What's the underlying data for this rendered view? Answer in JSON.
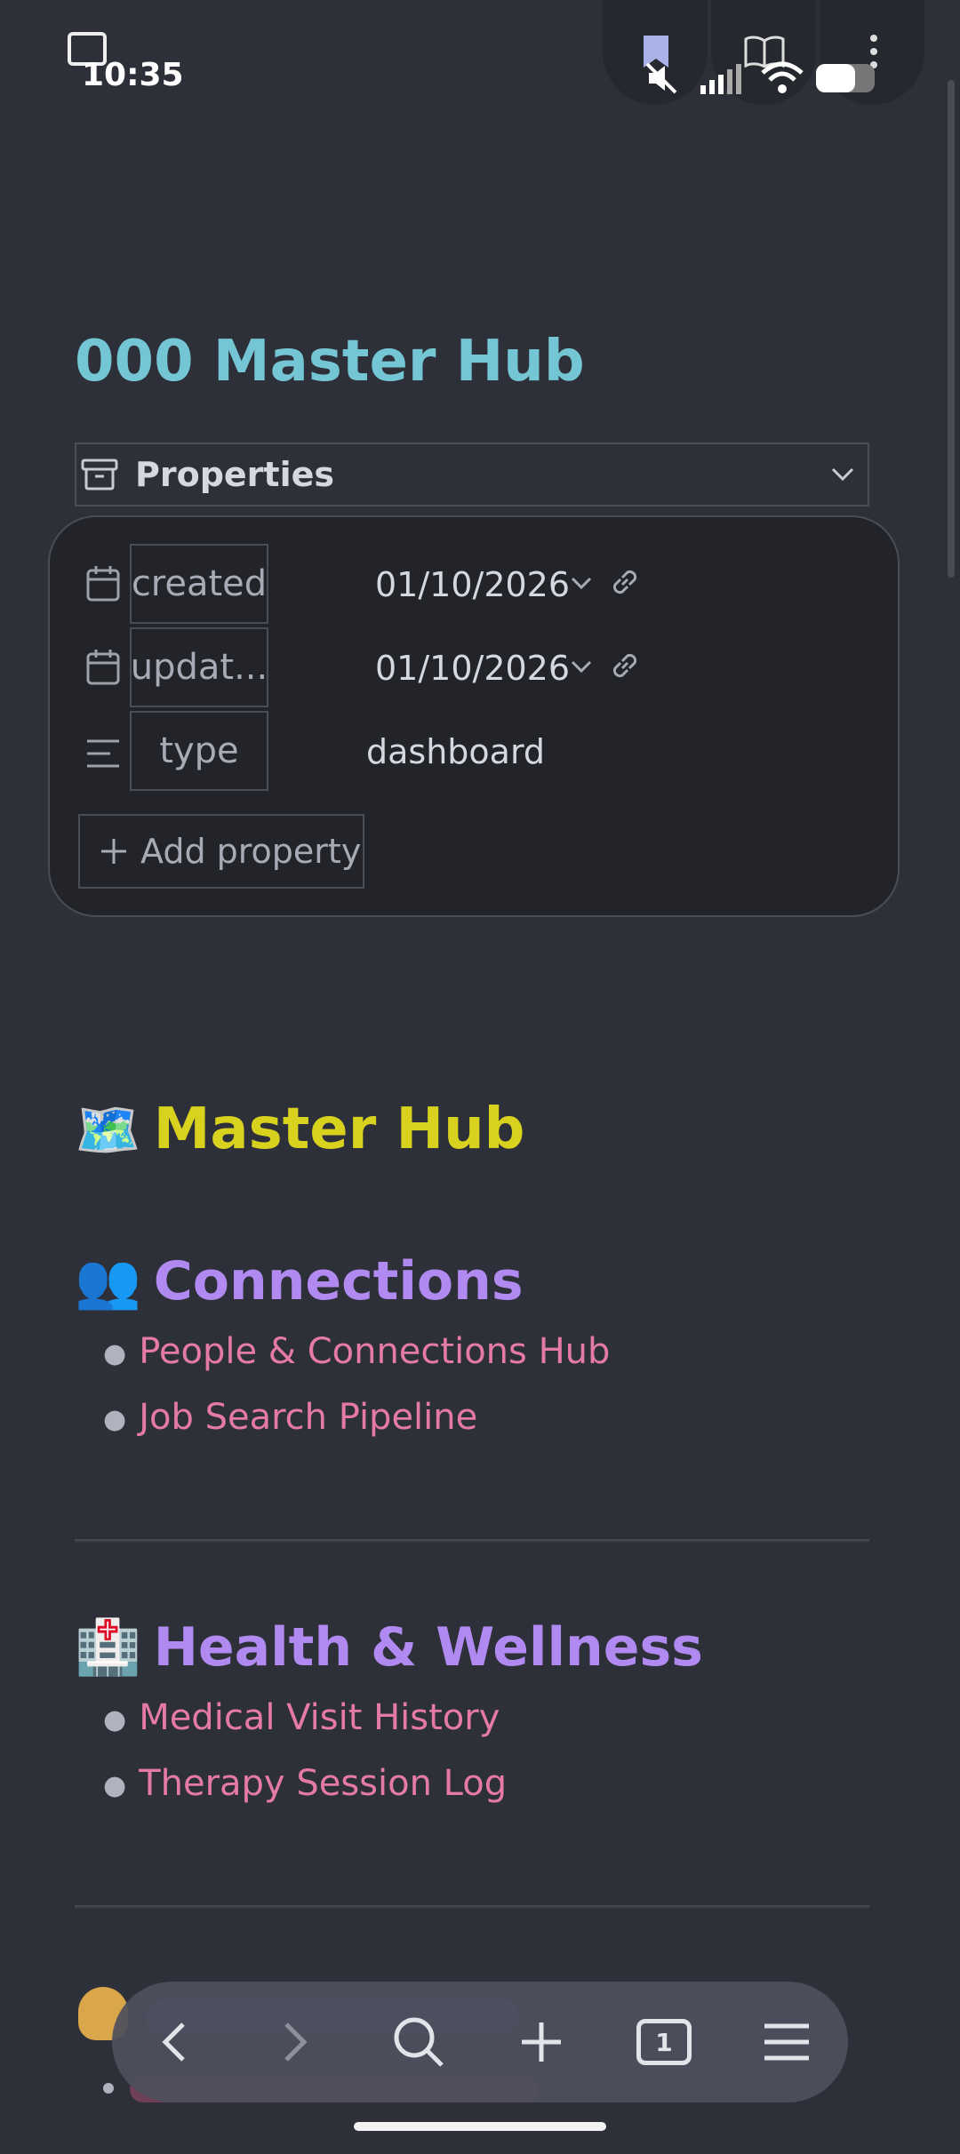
{
  "status_bar": {
    "time": "10:35"
  },
  "page": {
    "title": "000 Master Hub"
  },
  "properties": {
    "label": "Properties",
    "rows": [
      {
        "key": "created",
        "value": "01/10/2026"
      },
      {
        "key": "updat...",
        "value": "01/10/2026"
      },
      {
        "key": "type",
        "value": "dashboard"
      }
    ],
    "add_label": "Add property"
  },
  "content": {
    "heading": "Master Hub",
    "heading_emoji": "🗺️",
    "sections": [
      {
        "emoji": "👥",
        "title": "Connections",
        "links": [
          "People & Connections Hub",
          "Job Search Pipeline"
        ]
      },
      {
        "emoji": "🏥",
        "title": "Health & Wellness",
        "links": [
          "Medical Visit History",
          "Therapy Session Log"
        ]
      }
    ]
  },
  "bottom_nav": {
    "tab_count": "1"
  },
  "colors": {
    "title": "#74c6d4",
    "h1": "#d8d21e",
    "h2": "#b08af0",
    "link": "#e57aa8",
    "bg": "#2e3039"
  }
}
